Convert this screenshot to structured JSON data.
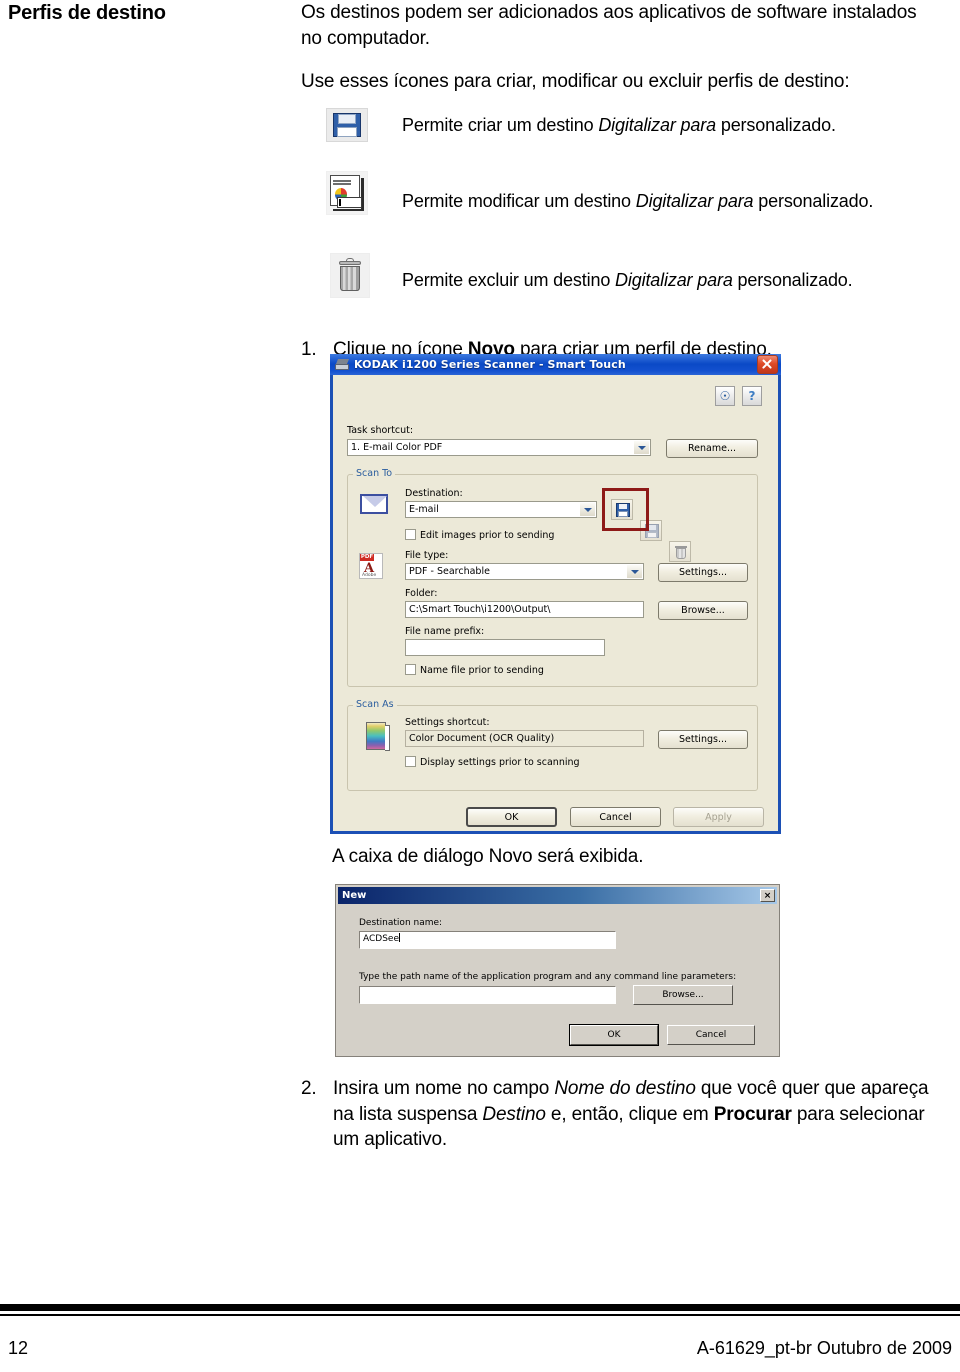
{
  "page": {
    "heading": "Perfis de destino",
    "intro_paragraph_1": "Os destinos podem ser adicionados aos aplicativos de software instalados no computador.",
    "intro_paragraph_2": "Use esses ícones para criar, modificar ou excluir perfis de destino:"
  },
  "icon_list": [
    {
      "icon": "floppy-save-icon",
      "desc_before": "Permite criar um destino ",
      "desc_italic": "Digitalizar para",
      "desc_after": " personalizado."
    },
    {
      "icon": "modify-document-icon",
      "desc_before": "Permite modificar um destino ",
      "desc_italic": "Digitalizar para",
      "desc_after": " personalizado."
    },
    {
      "icon": "trash-delete-icon",
      "desc_before": "Permite excluir um destino ",
      "desc_italic": "Digitalizar para",
      "desc_after": " personalizado."
    }
  ],
  "steps": [
    {
      "number": "1.",
      "text_a": "Clique no ícone ",
      "bold_a": "Novo",
      "text_b": " para criar um perfil de destino."
    },
    {
      "number": "2.",
      "text_a": "Insira um nome no campo ",
      "italic_a": "Nome do destino",
      "text_b": " que você quer que apareça na lista suspensa ",
      "italic_b": "Destino",
      "text_c": " e, então, clique em ",
      "bold_a": "Procurar",
      "text_d": " para selecionar um aplicativo."
    }
  ],
  "caption_new_dialog": "A caixa de diálogo Novo será exibida.",
  "smart_touch_dialog": {
    "title": "KODAK i1200 Series Scanner - Smart Touch",
    "close_label": "×",
    "task_shortcut_label": "Task shortcut:",
    "task_shortcut_value": "1. E-mail Color PDF",
    "rename_button": "Rename...",
    "help_icon_1": "configure-help-icon",
    "help_icon_2": "question-help-icon",
    "scan_to": {
      "group_label": "Scan To",
      "destination_label": "Destination:",
      "destination_value": "E-mail",
      "edit_images_checkbox": "Edit images prior to sending",
      "file_type_label": "File type:",
      "file_type_value": "PDF - Searchable",
      "file_type_settings_button": "Settings...",
      "folder_label": "Folder:",
      "folder_value": "C:\\Smart Touch\\i1200\\Output\\",
      "browse_button": "Browse...",
      "file_name_prefix_label": "File name prefix:",
      "file_name_prefix_value": "",
      "name_file_checkbox": "Name file prior to sending"
    },
    "scan_as": {
      "group_label": "Scan As",
      "settings_shortcut_label": "Settings shortcut:",
      "settings_shortcut_value": "Color Document (OCR Quality)",
      "settings_button": "Settings...",
      "display_settings_checkbox": "Display settings prior to scanning"
    },
    "buttons": {
      "ok": "OK",
      "cancel": "Cancel",
      "apply": "Apply"
    },
    "highlight_color": "#8e1a18",
    "titlebar_color": "#0a49c6"
  },
  "new_dialog": {
    "title": "New",
    "close_label": "×",
    "destination_name_label": "Destination name:",
    "destination_name_value": "ACDSee",
    "path_label": "Type the path name of the application program and any command line parameters:",
    "path_value": "",
    "browse_button": "Browse...",
    "ok_button": "OK",
    "cancel_button": "Cancel"
  },
  "footer": {
    "page_number": "12",
    "doc_reference": "A-61629_pt-br  Outubro de 2009"
  }
}
